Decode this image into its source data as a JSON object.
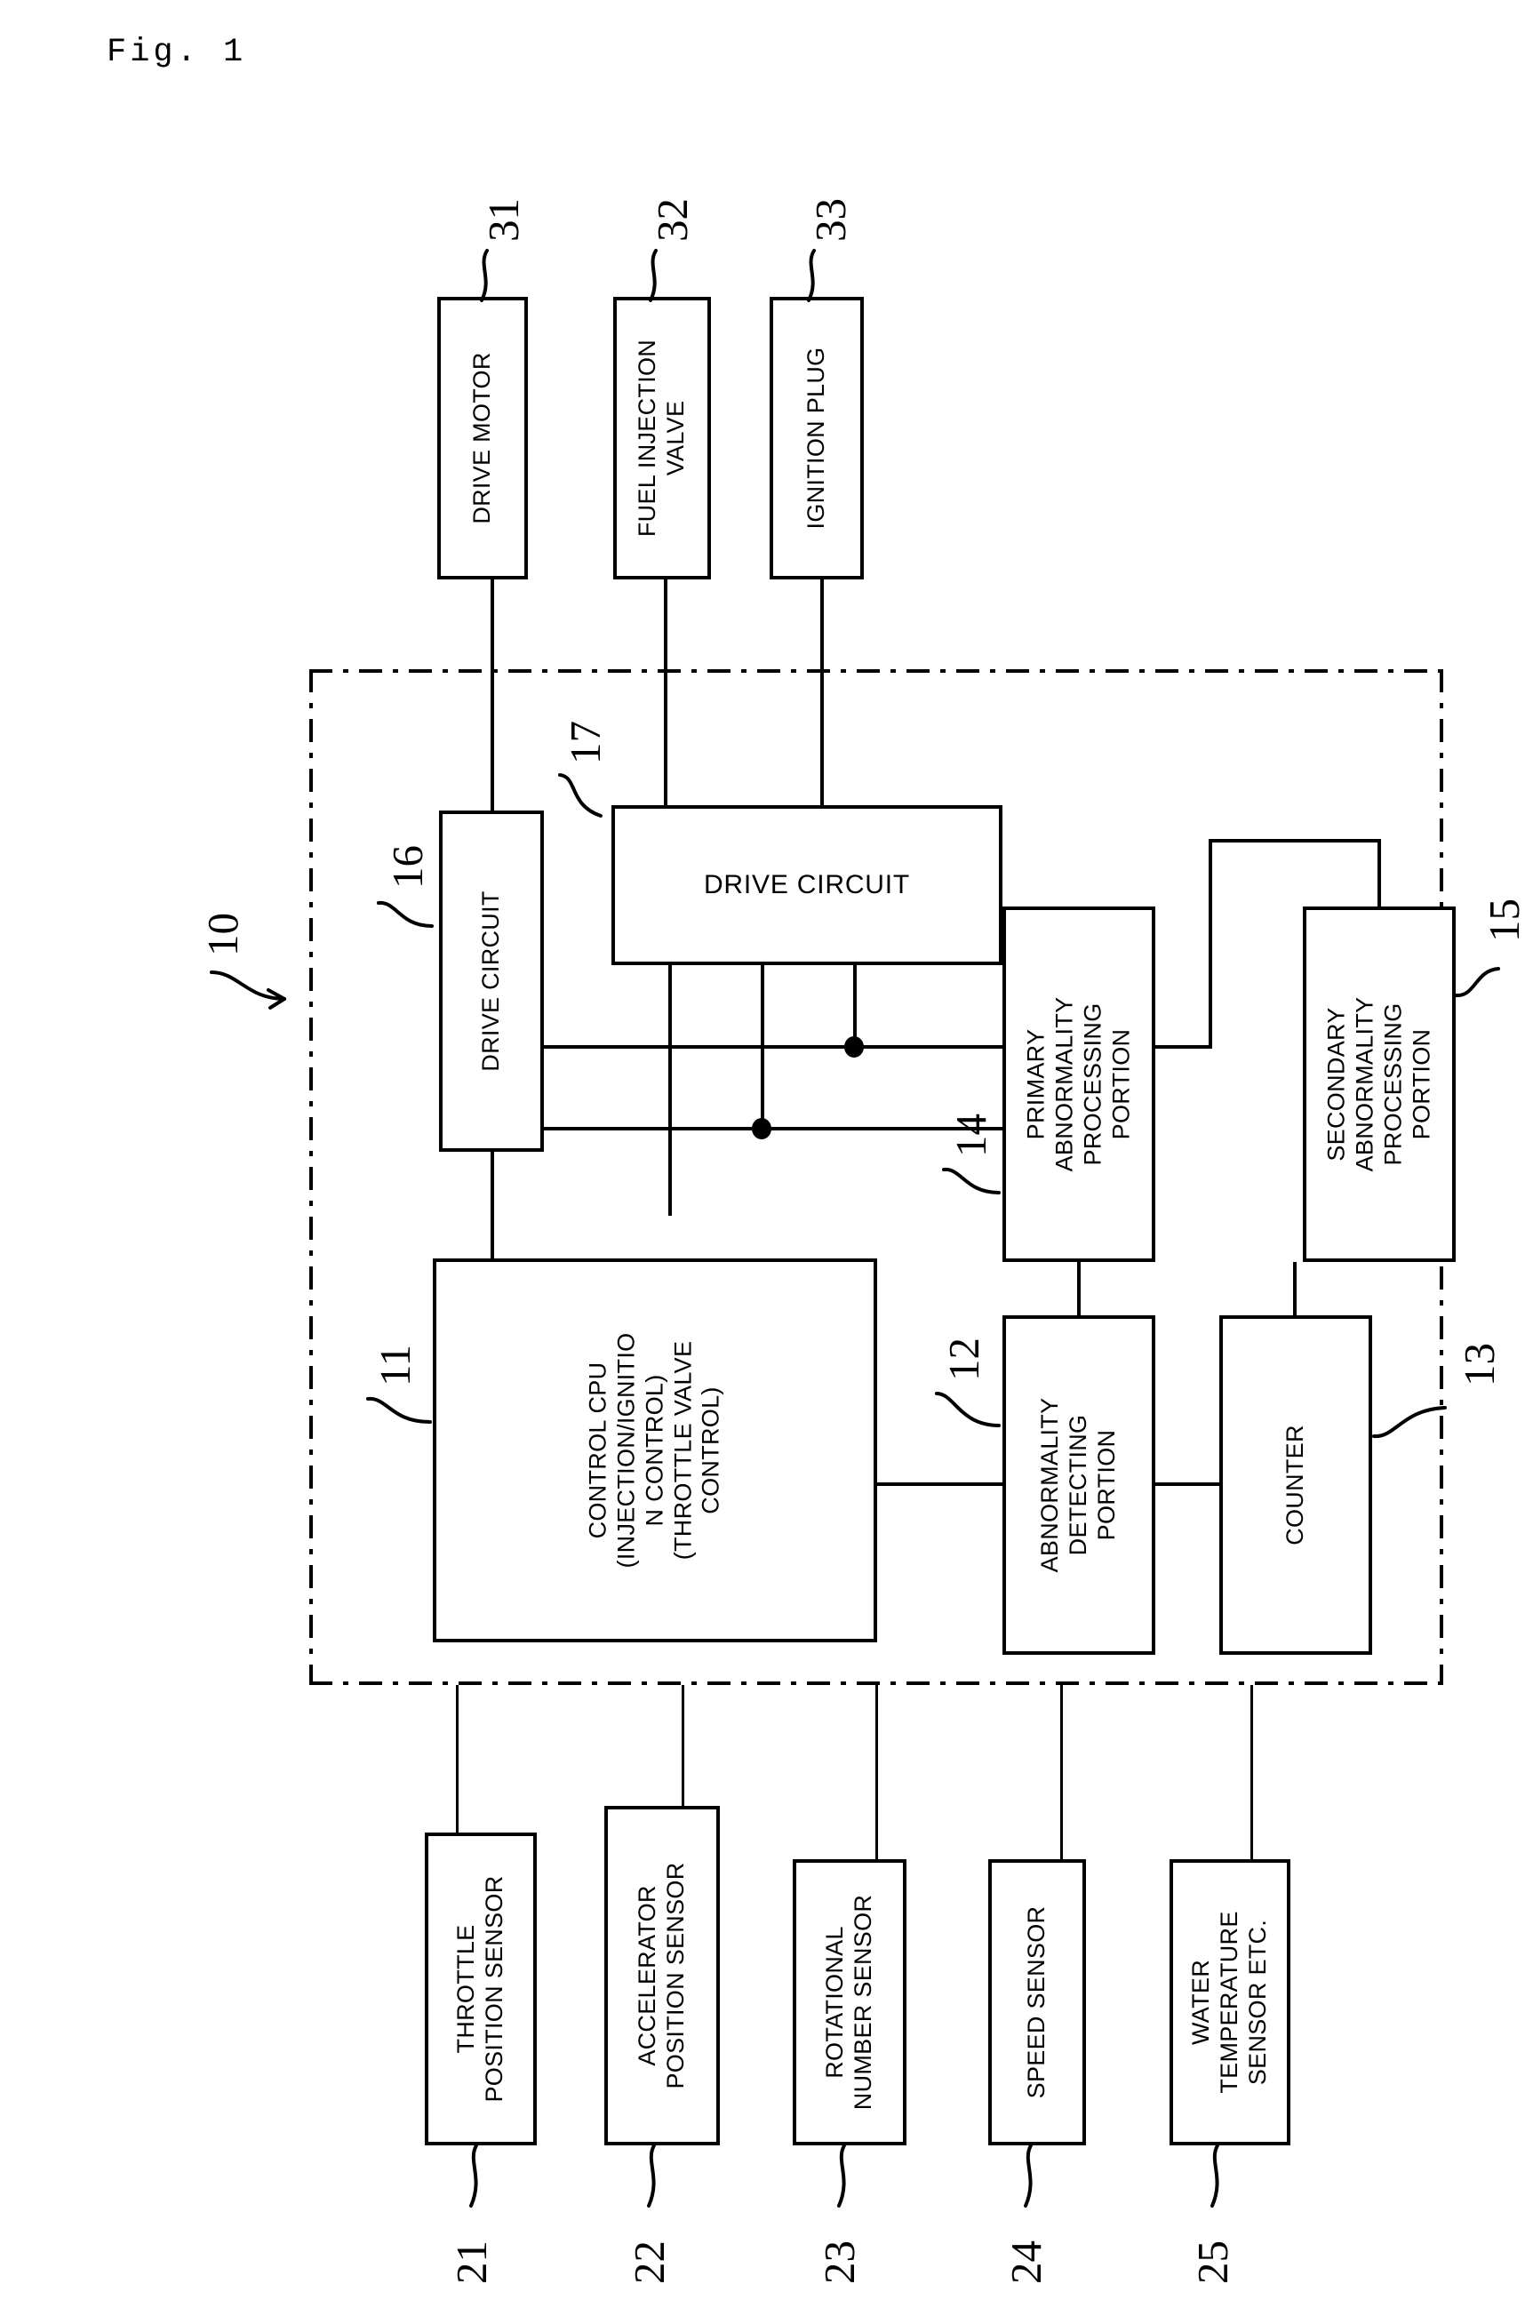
{
  "figure": {
    "caption": "Fig. 1"
  },
  "diagram": {
    "type": "block-diagram",
    "enclosure": {
      "ref": "10",
      "style": "dash-dot",
      "description": "Electronic control unit boundary"
    },
    "actuators": [
      {
        "ref": "31",
        "label": "DRIVE MOTOR"
      },
      {
        "ref": "32",
        "label": "FUEL INJECTION\nVALVE"
      },
      {
        "ref": "33",
        "label": "IGNITION PLUG"
      }
    ],
    "internal_blocks": [
      {
        "ref": "16",
        "label": "DRIVE CIRCUIT"
      },
      {
        "ref": "17",
        "label": "DRIVE CIRCUIT"
      },
      {
        "ref": "11",
        "label": "CONTROL CPU\n(INJECTION/IGNITIO\nN CONTROL)\n(THROTTLE VALVE\nCONTROL)"
      },
      {
        "ref": "14",
        "label": "PRIMARY\nABNORMALITY\nPROCESSING\nPORTION"
      },
      {
        "ref": "15",
        "label": "SECONDARY\nABNORMALITY\nPROCESSING\nPORTION"
      },
      {
        "ref": "12",
        "label": "ABNORMALITY\nDETECTING\nPORTION"
      },
      {
        "ref": "13",
        "label": "COUNTER"
      }
    ],
    "sensors": [
      {
        "ref": "21",
        "label": "THROTTLE\nPOSITION SENSOR"
      },
      {
        "ref": "22",
        "label": "ACCELERATOR\nPOSITION SENSOR"
      },
      {
        "ref": "23",
        "label": "ROTATIONAL\nNUMBER SENSOR"
      },
      {
        "ref": "24",
        "label": "SPEED SENSOR"
      },
      {
        "ref": "25",
        "label": "WATER\nTEMPERATURE\nSENSOR ETC."
      }
    ],
    "colors": {
      "ink": "#000000",
      "background": "#ffffff"
    }
  }
}
